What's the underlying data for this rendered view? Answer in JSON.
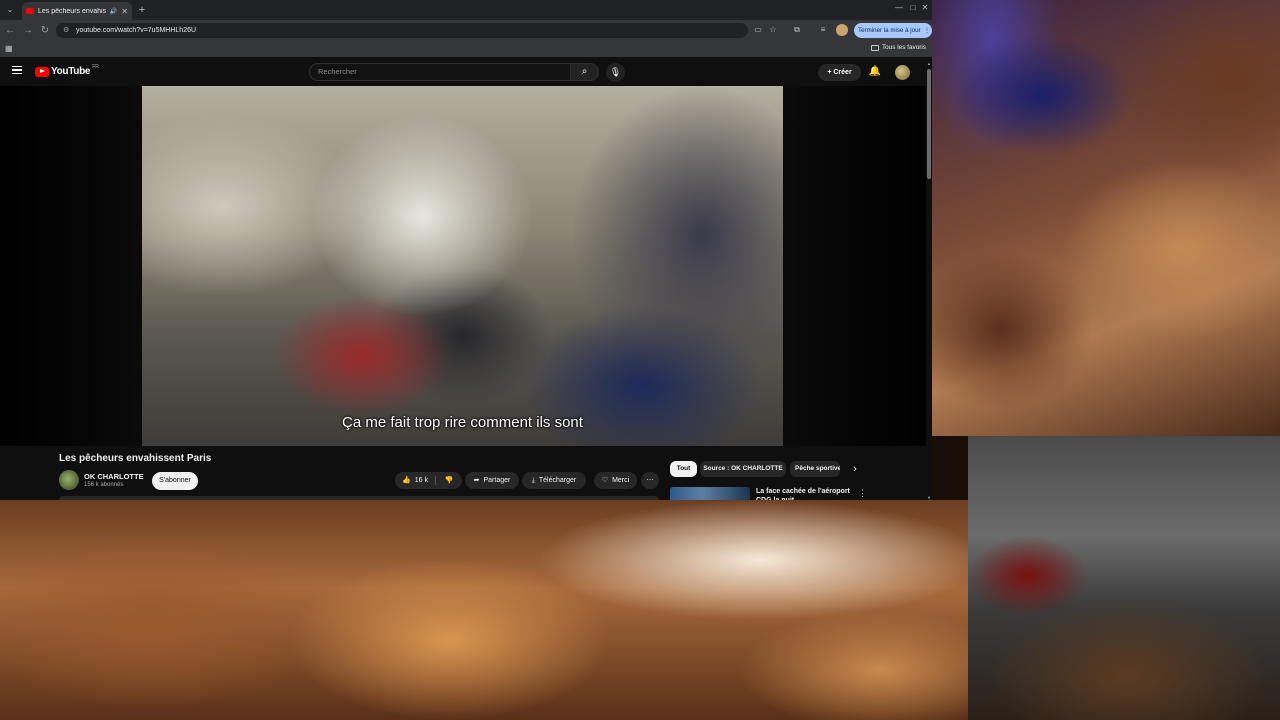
{
  "browser": {
    "tab_title": "Les pêcheurs envahissent P",
    "tab_sound_icon": "🔊",
    "url": "youtube.com/watch?v=7u5MHHLh26U",
    "update_button": "Terminer la mise à jour",
    "all_bookmarks": "Tous les favoris"
  },
  "youtube": {
    "logo_text": "YouTube",
    "logo_region": "FR",
    "search_placeholder": "Rechercher",
    "create_label": "Créer"
  },
  "video": {
    "caption": "Ça me fait trop rire comment ils sont",
    "title": "Les pêcheurs envahissent Paris",
    "channel_name": "OK CHARLOTTE",
    "channel_subs": "156 k abonnés",
    "subscribe_label": "S'abonner",
    "like_count": "16 k",
    "share_label": "Partager",
    "download_label": "Télécharger",
    "thanks_label": "Merci"
  },
  "sidebar": {
    "chips": [
      "Tout",
      "Source : OK CHARLOTTE",
      "Pêche sportive"
    ],
    "rec_title": "La face cachée de l'aéroport CDG la nuit"
  }
}
